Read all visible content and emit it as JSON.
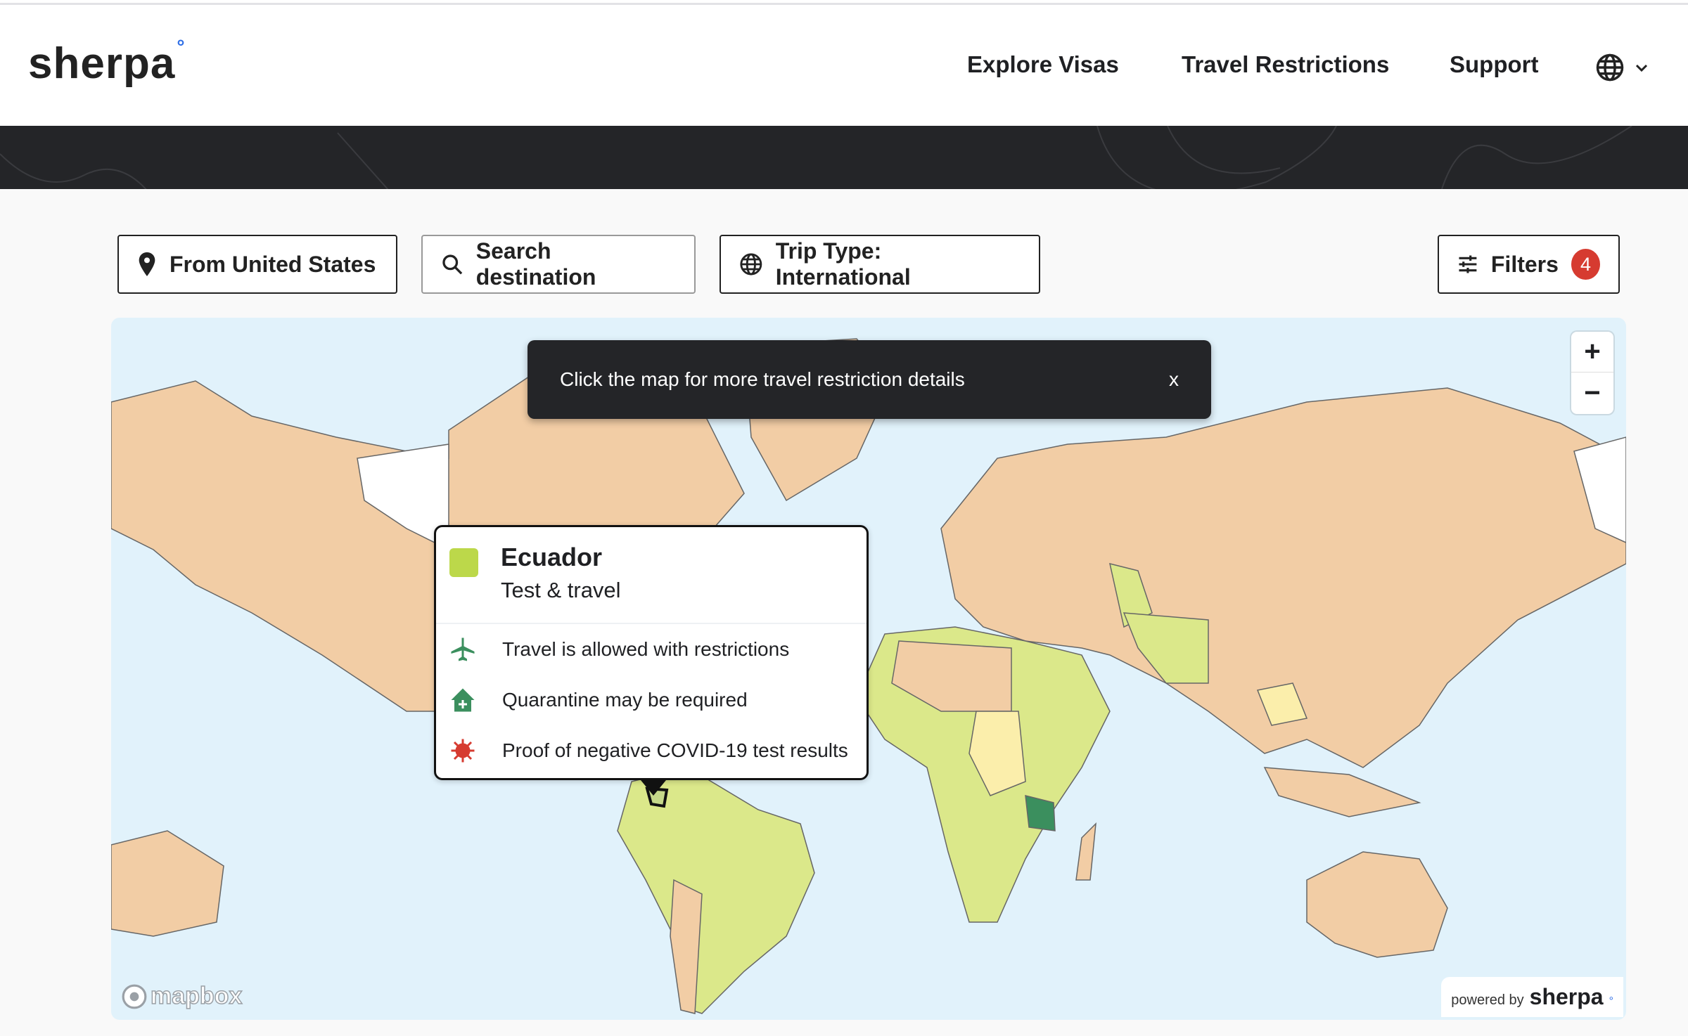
{
  "header": {
    "logo": "sherpa",
    "logo_mark": "°",
    "nav": [
      "Explore Visas",
      "Travel Restrictions",
      "Support"
    ],
    "language_icon": "globe-icon"
  },
  "toolbar": {
    "from": "From United States",
    "search_placeholder": "Search destination",
    "trip_type": "Trip Type: International",
    "filters": "Filters",
    "filters_count": "4"
  },
  "map": {
    "toast": "Click the map for more travel restriction details",
    "toast_close": "x",
    "zoom_in": "+",
    "zoom_out": "−",
    "attribution": "mapbox",
    "powered_by": "powered by",
    "powered_brand": "sherpa",
    "colors": {
      "water": "#e1f2fb",
      "restricted": "#f2cda5",
      "test_and_travel": "#dbe88a",
      "partial": "#fbeeab",
      "open": "#3b8f5e",
      "no_data": "#ffffff"
    },
    "popup": {
      "country": "Ecuador",
      "status": "Test & travel",
      "status_color": "#bcd84a",
      "rows": [
        {
          "icon": "airplane-icon",
          "color": "#3b8f5e",
          "text": "Travel is allowed with restrictions"
        },
        {
          "icon": "quarantine-house-icon",
          "color": "#3b8f5e",
          "text": "Quarantine may be required"
        },
        {
          "icon": "virus-icon",
          "color": "#d63b30",
          "text": "Proof of negative COVID-19 test results"
        }
      ]
    }
  }
}
